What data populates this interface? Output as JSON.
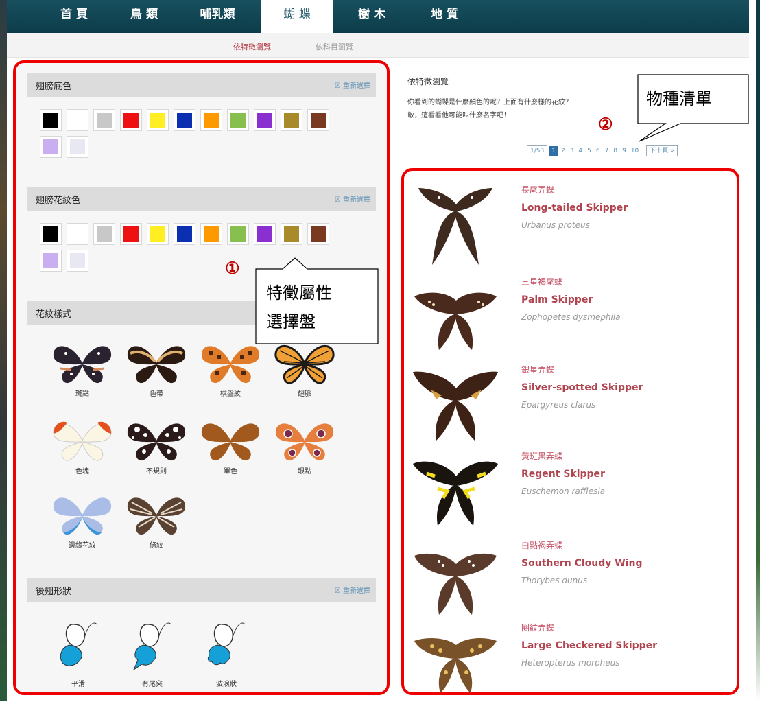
{
  "nav": {
    "tabs": [
      {
        "label": "首 頁"
      },
      {
        "label": "鳥 類"
      },
      {
        "label": "哺乳類"
      },
      {
        "label": "蝴 蝶"
      },
      {
        "label": "樹 木"
      },
      {
        "label": "地 質"
      }
    ],
    "active_tab": 3,
    "sub": [
      {
        "label": "依特徵瀏覽"
      },
      {
        "label": "依科目瀏覽"
      }
    ]
  },
  "filters": {
    "reset_label": "重新選擇",
    "wing_color": {
      "title": "翅膀底色",
      "colors": [
        "#000000",
        "#ffffff",
        "#c8c8c8",
        "#ee1111",
        "#ffee22",
        "#0a2fb0",
        "#ff9900",
        "#88c050",
        "#8a2fd0",
        "#a88a2a",
        "#7a3a22",
        "#c9aef0",
        "#e8e8f2"
      ]
    },
    "pattern_color": {
      "title": "翅膀花紋色",
      "colors": [
        "#000000",
        "#ffffff",
        "#c8c8c8",
        "#ee1111",
        "#ffee22",
        "#0a2fb0",
        "#ff9900",
        "#88c050",
        "#8a2fd0",
        "#a88a2a",
        "#7a3a22",
        "#c9aef0",
        "#e8e8f2"
      ]
    },
    "pattern_style": {
      "title": "花紋樣式",
      "items": [
        {
          "label": "斑點"
        },
        {
          "label": "色帶"
        },
        {
          "label": "棋盤紋"
        },
        {
          "label": "翅脈"
        },
        {
          "label": "色塊"
        },
        {
          "label": "不規則"
        },
        {
          "label": "單色"
        },
        {
          "label": "眼點"
        },
        {
          "label": "邊緣花紋"
        },
        {
          "label": "條紋"
        }
      ]
    },
    "hindwing": {
      "title": "後翅形狀",
      "items": [
        {
          "label": "平滑"
        },
        {
          "label": "有尾突"
        },
        {
          "label": "波浪狀"
        }
      ]
    }
  },
  "callouts": {
    "one_num": "①",
    "one_line1": "特徵屬性",
    "one_line2": "選擇盤",
    "two_num": "②",
    "two_text": "物種清單"
  },
  "results": {
    "title": "依特徵瀏覽",
    "desc_line1": "你看到的蝴蝶是什麼顏色的呢？上面有什麼樣的花紋？",
    "desc_line2": "敢，這看看他可能叫什麼名字吧！",
    "pager": {
      "page_info": "1/53",
      "pages": [
        "1",
        "2",
        "3",
        "4",
        "5",
        "6",
        "7",
        "8",
        "9",
        "10"
      ],
      "next_label": "下十頁 »"
    },
    "species": [
      {
        "zh": "長尾弄蝶",
        "en": "Long-tailed Skipper",
        "sci": "Urbanus proteus"
      },
      {
        "zh": "三星褐尾蝶",
        "en": "Palm Skipper",
        "sci": "Zophopetes dysmephila"
      },
      {
        "zh": "銀星弄蝶",
        "en": "Silver-spotted Skipper",
        "sci": "Epargyreus clarus"
      },
      {
        "zh": "黃斑黑弄蝶",
        "en": "Regent Skipper",
        "sci": "Euschemon rafflesia"
      },
      {
        "zh": "白點褐弄蝶",
        "en": "Southern Cloudy Wing",
        "sci": "Thorybes dunus"
      },
      {
        "zh": "圈紋弄蝶",
        "en": "Large Checkered Skipper",
        "sci": "Heteropterus morpheus"
      }
    ]
  }
}
